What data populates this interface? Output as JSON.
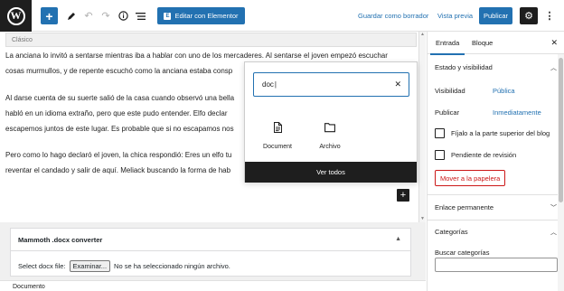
{
  "toolbar": {
    "add_icon": "plus-icon",
    "tools_icon": "pencil-icon",
    "undo_icon": "undo-icon",
    "redo_icon": "redo-icon",
    "details_icon": "info-icon",
    "list_view_icon": "list-icon",
    "elementor_label": "Editar con Elementor",
    "save_draft_label": "Guardar como borrador",
    "preview_label": "Vista previa",
    "publish_label": "Publicar",
    "settings_icon": "gear-icon",
    "more_icon": "more-vertical-icon"
  },
  "editor": {
    "classic_label": "Clásico",
    "paragraphs": [
      "La anciana lo invitó a sentarse mientras iba a hablar con uno de los mercaderes. Al sentarse el joven empezó escuchar",
      "cosas murmullos, y de repente escuchó como la anciana estaba consp",
      "Al darse cuenta de su suerte salió de la casa cuando observó una bella",
      "habló en un idioma extraño, pero que este pudo entender. Elfo declar",
      "escapemos juntos de este lugar. Es probable que si no escapamos nos",
      "Pero como lo hago declaró el joven, la chica respondió: Eres un elfo tu",
      "reventar el candado y salir de aquí. Meliack buscando la forma de hab"
    ]
  },
  "metabox": {
    "title": "Mammoth .docx converter",
    "select_label": "Select docx file:",
    "browse_label": "Examinar...",
    "no_file_text": "No se ha seleccionado ningún archivo."
  },
  "footer": {
    "breadcrumb": "Documento"
  },
  "sidebar": {
    "tab_post": "Entrada",
    "tab_block": "Bloque",
    "status_title": "Estado y visibilidad",
    "visibility_label": "Visibilidad",
    "visibility_value": "Pública",
    "publish_label": "Publicar",
    "publish_value": "Inmediatamente",
    "sticky_label": "Fíjalo a la parte superior del blog",
    "pending_label": "Pendiente de revisión",
    "trash_label": "Mover a la papelera",
    "permalink_title": "Enlace permanente",
    "categories_title": "Categorías",
    "search_categories_label": "Buscar categorías"
  },
  "inserter": {
    "search_value": "doc",
    "results": [
      {
        "label": "Document",
        "icon": "document-icon"
      },
      {
        "label": "Archivo",
        "icon": "folder-icon"
      }
    ],
    "view_all_label": "Ver todos"
  }
}
